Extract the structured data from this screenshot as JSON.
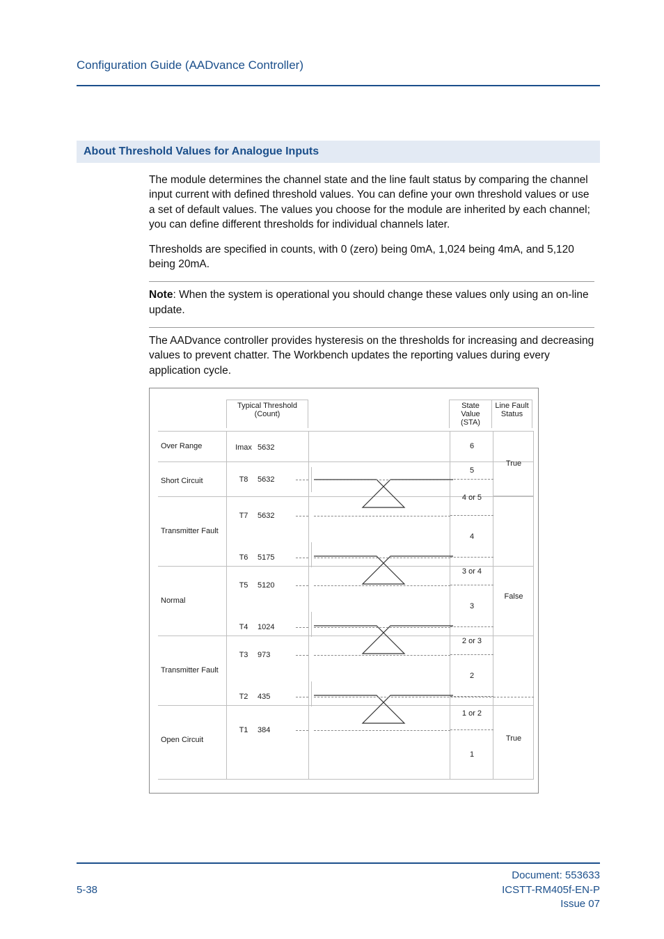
{
  "page_header": "Configuration Guide (AADvance Controller)",
  "section_heading": "About Threshold Values for Analogue Inputs",
  "paragraphs": {
    "p1": "The module determines the channel state and the line fault status by comparing the channel input current with defined threshold values. You can define your own threshold values or use a set of default values. The values you choose for the module are inherited by each channel; you can define different thresholds for individual channels later.",
    "p2": "Thresholds are specified in counts, with 0 (zero) being 0mA, 1,024 being 4mA, and 5,120 being 20mA.",
    "note_label": "Note",
    "note_text": ": When the system is operational you should change these values only using an on-line update.",
    "p3": "The AADvance controller provides hysteresis on the thresholds for increasing and decreasing values to prevent chatter. The Workbench updates the reporting values during every application cycle."
  },
  "diagram": {
    "headers": {
      "typical_threshold": "Typical Threshold\n(Count)",
      "state_value": "State Value\n(STA)",
      "line_fault": "Line Fault\nStatus"
    },
    "states": [
      {
        "name": "Over Range"
      },
      {
        "name": "Short Circuit"
      },
      {
        "name": "Transmitter Fault"
      },
      {
        "name": "Normal"
      },
      {
        "name": "Transmitter Fault"
      },
      {
        "name": "Open Circuit"
      }
    ],
    "thresholds": [
      {
        "label": "Imax",
        "value": "5632"
      },
      {
        "label": "T8",
        "value": "5632"
      },
      {
        "label": "T7",
        "value": "5632"
      },
      {
        "label": "T6",
        "value": "5175"
      },
      {
        "label": "T5",
        "value": "5120"
      },
      {
        "label": "T4",
        "value": "1024"
      },
      {
        "label": "T3",
        "value": "973"
      },
      {
        "label": "T2",
        "value": "435"
      },
      {
        "label": "T1",
        "value": "384"
      }
    ],
    "state_values": [
      "6",
      "5",
      "4 or 5",
      "4",
      "3 or 4",
      "3",
      "2 or 3",
      "2",
      "1 or 2",
      "1"
    ],
    "line_fault_status": [
      "True",
      "False",
      "True"
    ]
  },
  "footer": {
    "page_num": "5-38",
    "doc_line1": "Document: 553633",
    "doc_line2": "ICSTT-RM405f-EN-P",
    "doc_line3": "Issue 07"
  },
  "chart_data": {
    "type": "table",
    "title": "Analogue input threshold bands",
    "xlabel": "",
    "ylabel": "Count",
    "ylim": [
      0,
      5632
    ],
    "thresholds": [
      {
        "name": "Imax",
        "count": 5632
      },
      {
        "name": "T8",
        "count": 5632
      },
      {
        "name": "T7",
        "count": 5632
      },
      {
        "name": "T6",
        "count": 5175
      },
      {
        "name": "T5",
        "count": 5120
      },
      {
        "name": "T4",
        "count": 1024
      },
      {
        "name": "T3",
        "count": 973
      },
      {
        "name": "T2",
        "count": 435
      },
      {
        "name": "T1",
        "count": 384
      }
    ],
    "bands": [
      {
        "state": "Over Range",
        "between": [
          "Imax",
          "∞"
        ],
        "sta": "6",
        "line_fault": "True"
      },
      {
        "state": "Short Circuit",
        "between": [
          "T8",
          "Imax"
        ],
        "sta": "5",
        "line_fault": "True"
      },
      {
        "state": "hysteresis",
        "between": [
          "T7",
          "T8"
        ],
        "sta": "4 or 5",
        "line_fault": "True"
      },
      {
        "state": "Transmitter Fault",
        "between": [
          "T6",
          "T7"
        ],
        "sta": "4",
        "line_fault": "False"
      },
      {
        "state": "hysteresis",
        "between": [
          "T5",
          "T6"
        ],
        "sta": "3 or 4",
        "line_fault": "False"
      },
      {
        "state": "Normal",
        "between": [
          "T4",
          "T5"
        ],
        "sta": "3",
        "line_fault": "False"
      },
      {
        "state": "hysteresis",
        "between": [
          "T3",
          "T4"
        ],
        "sta": "2 or 3",
        "line_fault": "False"
      },
      {
        "state": "Transmitter Fault",
        "between": [
          "T2",
          "T3"
        ],
        "sta": "2",
        "line_fault": "False"
      },
      {
        "state": "hysteresis",
        "between": [
          "T1",
          "T2"
        ],
        "sta": "1 or 2",
        "line_fault": "True"
      },
      {
        "state": "Open Circuit",
        "between": [
          "0",
          "T1"
        ],
        "sta": "1",
        "line_fault": "True"
      }
    ]
  }
}
